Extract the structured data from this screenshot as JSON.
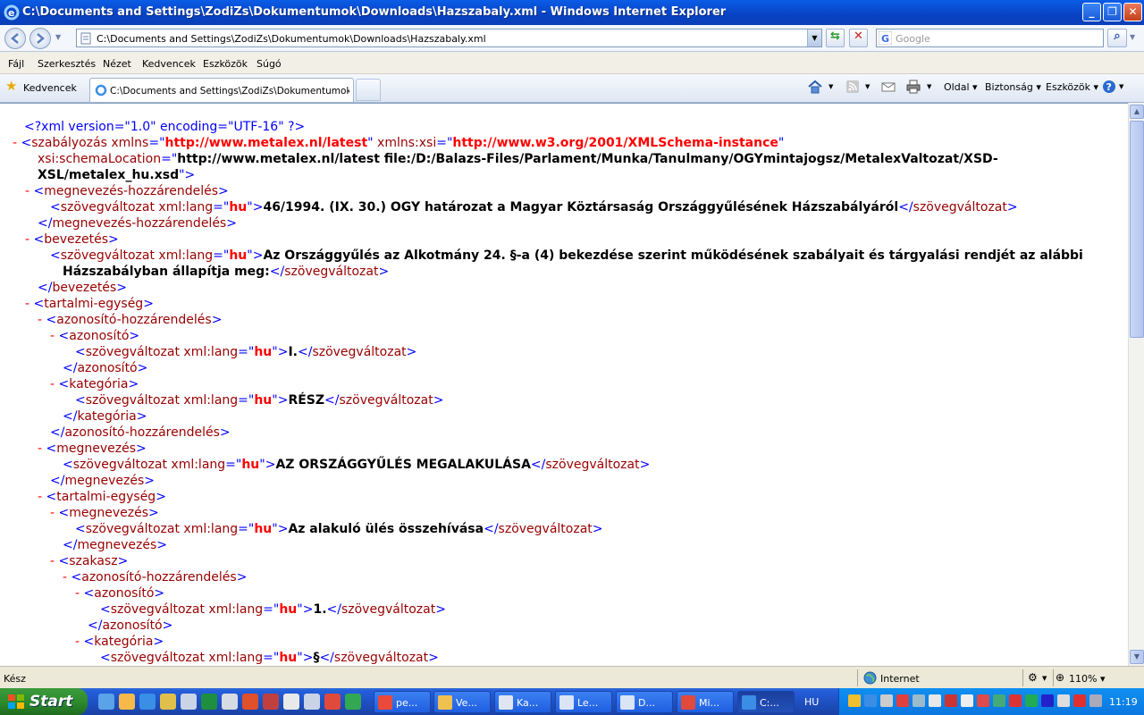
{
  "window": {
    "title": "C:\\Documents and Settings\\ZodiZs\\Dokumentumok\\Downloads\\Hazszabaly.xml - Windows Internet Explorer",
    "minimize": "_",
    "maximize": "❐",
    "close": "✕"
  },
  "address": {
    "url": "C:\\Documents and Settings\\ZodiZs\\Dokumentumok\\Downloads\\Hazszabaly.xml",
    "search_placeholder": "Google"
  },
  "menu": [
    "Fájl",
    "Szerkesztés",
    "Nézet",
    "Kedvencek",
    "Eszközök",
    "Súgó"
  ],
  "favorites_label": "Kedvencek",
  "tab_label": "C:\\Documents and Settings\\ZodiZs\\Dokumentumok\\D...",
  "commandbar": {
    "page": "Oldal ▾",
    "safety": "Biztonság ▾",
    "tools": "Eszközök ▾"
  },
  "xml": {
    "decl": "<?xml version=\"1.0\" encoding=\"UTF-16\" ?>",
    "root_tag": "szabályozás",
    "root_attr1_name": "xmlns",
    "root_attr1_val": "http://www.metalex.nl/latest",
    "root_attr2_name": "xmlns:xsi",
    "root_attr2_val": "http://www.w3.org/2001/XMLSchema-instance",
    "root_attr3_name": "xsi:schemaLocation",
    "root_attr3_val_a": "http://www.metalex.nl/latest file:/D:/Balazs-Files/Parlament/Munka/Tanulmany/OGYmintajogsz/MetalexValtozat/XSD-",
    "root_attr3_val_b": "XSL/metalex_hu.xsd",
    "tag_mh": "megnevezés-hozzárendelés",
    "tag_sv": "szövegváltozat",
    "attr_lang": "xml:lang",
    "lang_val": "hu",
    "text_title": "46/1994. (IX. 30.) OGY határozat a Magyar Köztársaság Országgyűlésének Házszabályáról",
    "tag_bev": "bevezetés",
    "text_bev_a": "Az Országgyűlés az Alkotmány 24. §-a (4) bekezdése szerint működésének szabályait és tárgyalási rendjét az alábbi",
    "text_bev_b": "Házszabályban állapítja meg:",
    "tag_te": "tartalmi-egység",
    "tag_ah": "azonosító-hozzárendelés",
    "tag_az": "azonosító",
    "text_I": "I.",
    "tag_kat": "kategória",
    "text_resz": "RÉSZ",
    "tag_megn": "megnevezés",
    "text_alak": "AZ ORSZÁGGYŰLÉS MEGALAKULÁSA",
    "text_alakulo": "Az alakuló ülés összehívása",
    "tag_szakasz": "szakasz",
    "text_1": "1.",
    "text_par": "§",
    "collapse": "-"
  },
  "status": {
    "text": "Kész",
    "zone": "Internet",
    "zoom": "110%  ▾"
  },
  "taskbar": {
    "start": "Start",
    "buttons": [
      "pe...",
      "Ve...",
      "Ka...",
      "Le...",
      "D...",
      "Mi...",
      "C:..."
    ],
    "lang": "HU",
    "clock": "11:19"
  },
  "colors": {
    "markup": "#0000ff",
    "tag": "#990000",
    "value": "#ff0000",
    "titlebar": "#0a5ce6"
  }
}
